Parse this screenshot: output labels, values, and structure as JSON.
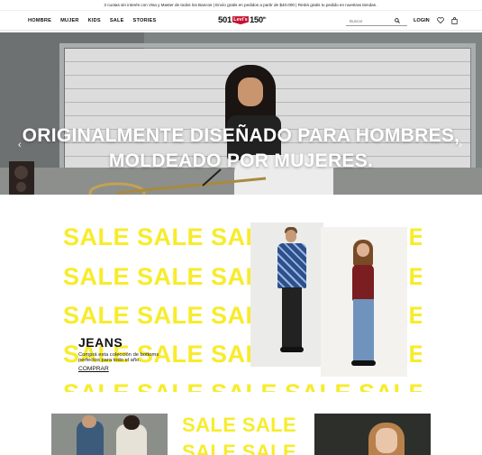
{
  "promo": {
    "text": "3 cuotas sin interés con Visa y Master de todos los Bancos | Envío gratis en pedidos a partir de $40.000 | Retirá gratis tu pedido en nuestras tiendas ."
  },
  "nav": {
    "links": [
      "HOMBRE",
      "MUJER",
      "KIDS",
      "SALE",
      "STORIES"
    ],
    "logo": {
      "left": "501",
      "mark": "Levi's",
      "right": "150",
      "right_sup": "th"
    },
    "search_placeholder": "Buscar",
    "login": "LOGIN"
  },
  "hero": {
    "line1": "ORIGINALMENTE DISEÑADO PARA HOMBRES,",
    "line2": "MOLDEADO POR MUJERES.",
    "prev_arrow": "‹",
    "next_arrow": "›"
  },
  "sale_banner": {
    "word": "SALE SALE SALE SALE SALE SALE"
  },
  "feature": {
    "title": "JEANS",
    "description": "Comprá esta colección de bottoms perfectos para todo el año.",
    "cta": "COMPRAR"
  },
  "tiles": {
    "sale_word": "SALE SALE SALE"
  },
  "colors": {
    "brand_red": "#c41230",
    "sale_yellow": "#f7ec2c"
  }
}
